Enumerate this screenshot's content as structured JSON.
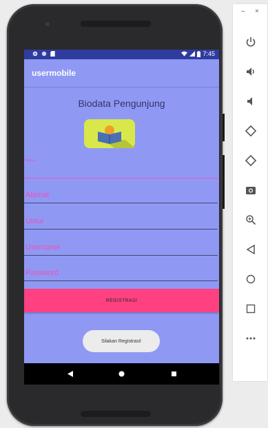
{
  "status_bar": {
    "time": "7:45"
  },
  "app": {
    "title": "usermobile",
    "page_title": "Biodata Pengunjung"
  },
  "form": {
    "nama_label": "Nama",
    "alamat_hint": "Alamat",
    "umur_hint": "Umur",
    "username_hint": "Username",
    "password_hint": "Password",
    "submit_label": "REGISTRASI"
  },
  "toast": {
    "message": "Silakan Registrasi!"
  },
  "emulator_panel": {
    "minimize": "–",
    "close": "×",
    "tools": [
      "power-icon",
      "volume-up-icon",
      "volume-down-icon",
      "rotate-left-icon",
      "rotate-right-icon",
      "camera-icon",
      "zoom-icon",
      "back-icon",
      "home-icon",
      "overview-icon",
      "more-icon"
    ]
  },
  "colors": {
    "screen_bg": "#8f99f4",
    "status_bar": "#2f3c9e",
    "accent": "#f14fb7",
    "button": "#ff4081"
  }
}
